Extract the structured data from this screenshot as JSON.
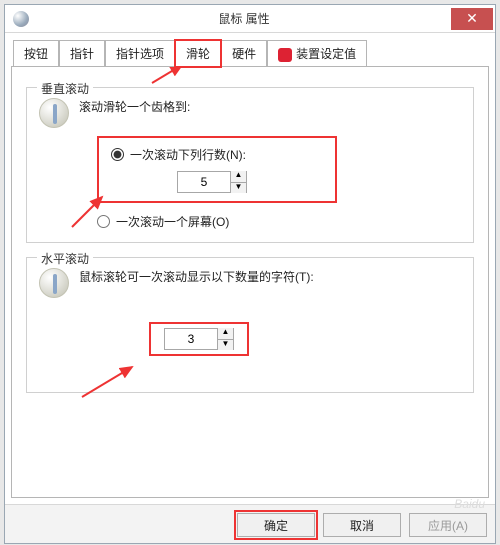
{
  "window": {
    "title": "鼠标 属性",
    "close_glyph": "✕"
  },
  "tabs": {
    "items": [
      {
        "label": "按钮"
      },
      {
        "label": "指针"
      },
      {
        "label": "指针选项"
      },
      {
        "label": "滑轮",
        "selected": true,
        "highlighted": true
      },
      {
        "label": "硬件"
      },
      {
        "label": "装置设定值",
        "icon": true
      }
    ]
  },
  "vertical_group": {
    "legend": "垂直滚动",
    "intro": "滚动滑轮一个齿格到:",
    "radio_lines": {
      "label": "一次滚动下列行数(N):",
      "checked": true
    },
    "lines_value": "5",
    "radio_screen": {
      "label": "一次滚动一个屏幕(O)",
      "checked": false
    }
  },
  "horizontal_group": {
    "legend": "水平滚动",
    "intro": "鼠标滚轮可一次滚动显示以下数量的字符(T):",
    "chars_value": "3"
  },
  "buttons": {
    "ok": "确定",
    "cancel": "取消",
    "apply": "应用(A)"
  },
  "icons": {
    "spin_up": "▲",
    "spin_down": "▼"
  }
}
